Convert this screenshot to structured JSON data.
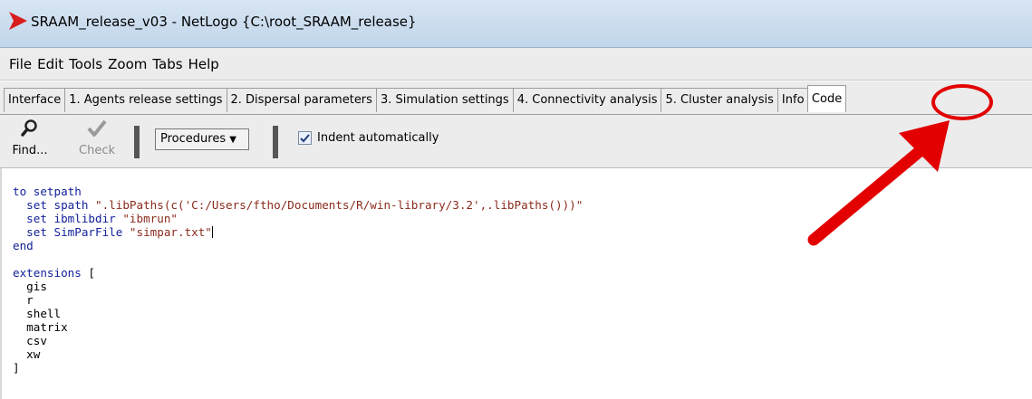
{
  "window": {
    "title": "SRAAM_release_v03 - NetLogo {C:\\root_SRAAM_release}",
    "app_icon": "netlogo-red-arrow-icon"
  },
  "menu": [
    "File",
    "Edit",
    "Tools",
    "Zoom",
    "Tabs",
    "Help"
  ],
  "tabs": [
    {
      "label": "Interface"
    },
    {
      "label": "1. Agents release settings"
    },
    {
      "label": "2. Dispersal parameters"
    },
    {
      "label": "3. Simulation settings"
    },
    {
      "label": "4. Connectivity analysis"
    },
    {
      "label": "5. Cluster analysis"
    },
    {
      "label": "Info"
    },
    {
      "label": "Code",
      "active": true
    }
  ],
  "toolbar": {
    "find_label": "Find...",
    "check_label": "Check",
    "procedures_label": "Procedures",
    "indent_label": "Indent automatically",
    "indent_checked": true
  },
  "code": {
    "line0": "to setpath",
    "line1_kw": "  set spath ",
    "line1_str": "\".libPaths(c('C:/Users/ftho/Documents/R/win-library/3.2',.libPaths()))\"",
    "line2_kw": "  set ibmlibdir ",
    "line2_str": "\"ibmrun\"",
    "line3_kw": "  set SimParFile ",
    "line3_str": "\"simpar.txt\"",
    "line4": "end",
    "line6_kw": "extensions ",
    "line6_plain": "[",
    "line7": "  gis",
    "line8": "  r",
    "line9": "  shell",
    "line10": "  matrix",
    "line11": "  csv",
    "line12": "  xw",
    "line13": "]"
  },
  "annotation": {
    "color": "#e20000",
    "target": "Code"
  }
}
